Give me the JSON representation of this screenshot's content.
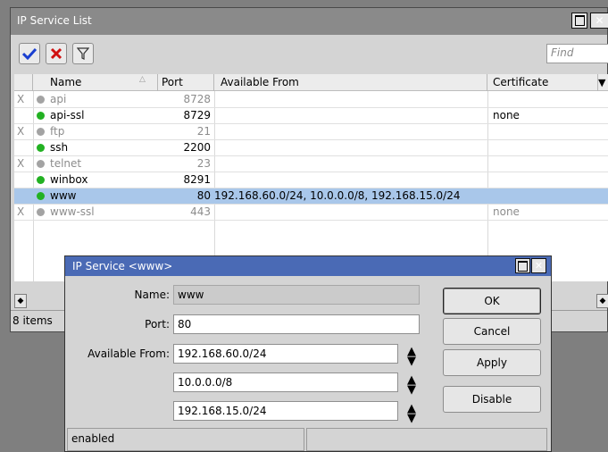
{
  "main_window": {
    "title": "IP Service List",
    "toolbar": {
      "find_placeholder": "Find"
    },
    "columns": {
      "name": "Name",
      "port": "Port",
      "available_from": "Available From",
      "certificate": "Certificate"
    },
    "rows": [
      {
        "flag": "X",
        "status": "disabled",
        "name": "api",
        "port": "8728",
        "available_from": "",
        "certificate": ""
      },
      {
        "flag": "",
        "status": "enabled",
        "name": "api-ssl",
        "port": "8729",
        "available_from": "",
        "certificate": "none"
      },
      {
        "flag": "X",
        "status": "disabled",
        "name": "ftp",
        "port": "21",
        "available_from": "",
        "certificate": ""
      },
      {
        "flag": "",
        "status": "enabled",
        "name": "ssh",
        "port": "2200",
        "available_from": "",
        "certificate": ""
      },
      {
        "flag": "X",
        "status": "disabled",
        "name": "telnet",
        "port": "23",
        "available_from": "",
        "certificate": ""
      },
      {
        "flag": "",
        "status": "enabled",
        "name": "winbox",
        "port": "8291",
        "available_from": "",
        "certificate": ""
      },
      {
        "flag": "",
        "status": "enabled",
        "name": "www",
        "port": "80",
        "available_from": "192.168.60.0/24, 10.0.0.0/8, 192.168.15.0/24",
        "certificate": "",
        "selected": true
      },
      {
        "flag": "X",
        "status": "disabled",
        "name": "www-ssl",
        "port": "443",
        "available_from": "",
        "certificate": "none"
      }
    ],
    "status_text": "8 items"
  },
  "dialog": {
    "title": "IP Service <www>",
    "name_label": "Name:",
    "name_value": "www",
    "port_label": "Port:",
    "port_value": "80",
    "available_from_label": "Available From:",
    "available_from_values": [
      "192.168.60.0/24",
      "10.0.0.0/8",
      "192.168.15.0/24"
    ],
    "buttons": {
      "ok": "OK",
      "cancel": "Cancel",
      "apply": "Apply",
      "disable": "Disable"
    },
    "status": "enabled"
  },
  "colors": {
    "dialog_title_bar": "#4a6ab5",
    "selected_row": "#a9c7ea",
    "enabled_dot": "#22b122",
    "disabled_dot": "#a3a3a3"
  }
}
